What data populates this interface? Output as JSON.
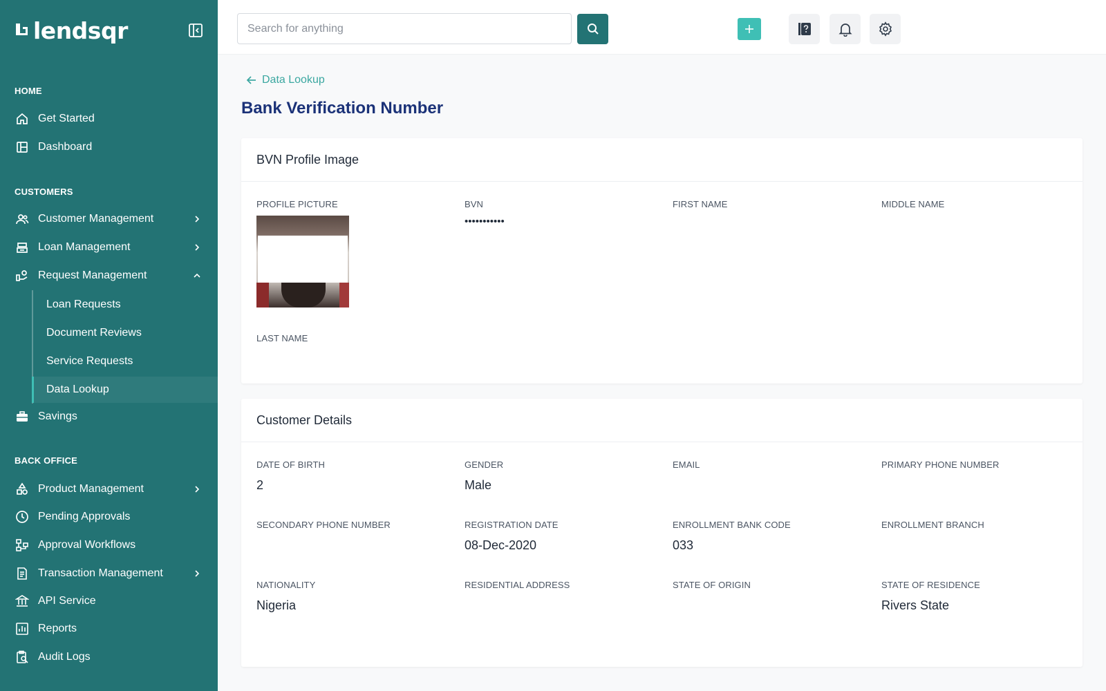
{
  "brand": {
    "name": "lendsqr"
  },
  "sidebar": {
    "sections": {
      "home": "HOME",
      "customers": "CUSTOMERS",
      "back_office": "BACK OFFICE"
    },
    "home_items": [
      {
        "label": "Get Started",
        "icon": "home-icon"
      },
      {
        "label": "Dashboard",
        "icon": "dashboard-icon"
      }
    ],
    "customer_items": [
      {
        "label": "Customer Management",
        "icon": "users-icon"
      },
      {
        "label": "Loan Management",
        "icon": "loan-icon"
      },
      {
        "label": "Request Management",
        "icon": "request-icon"
      }
    ],
    "request_sub_items": [
      {
        "label": "Loan Requests"
      },
      {
        "label": "Document Reviews"
      },
      {
        "label": "Service Requests"
      },
      {
        "label": "Data Lookup"
      }
    ],
    "savings": {
      "label": "Savings",
      "icon": "briefcase-icon"
    },
    "back_office_items": [
      {
        "label": "Product Management",
        "icon": "shapes-icon"
      },
      {
        "label": "Pending Approvals",
        "icon": "clock-icon"
      },
      {
        "label": "Approval Workflows",
        "icon": "workflow-icon"
      },
      {
        "label": "Transaction Management",
        "icon": "transaction-icon"
      },
      {
        "label": "API Service",
        "icon": "bank-icon"
      },
      {
        "label": "Reports",
        "icon": "report-icon"
      },
      {
        "label": "Audit Logs",
        "icon": "audit-icon"
      }
    ]
  },
  "topbar": {
    "search_placeholder": "Search for anything"
  },
  "main": {
    "back_link": "Data Lookup",
    "title": "Bank Verification Number",
    "profile_card": {
      "title": "BVN Profile Image",
      "fields": {
        "profile_picture": "PROFILE PICTURE",
        "bvn_label": "BVN",
        "bvn_value": "•••••••••••",
        "first_name": "FIRST NAME",
        "middle_name": "MIDDLE NAME",
        "last_name": "LAST NAME"
      }
    },
    "details_card": {
      "title": "Customer Details",
      "fields": [
        {
          "label": "DATE OF BIRTH",
          "value": "2"
        },
        {
          "label": "GENDER",
          "value": "Male"
        },
        {
          "label": "EMAIL",
          "value": ""
        },
        {
          "label": "PRIMARY PHONE NUMBER",
          "value": ""
        },
        {
          "label": "SECONDARY PHONE NUMBER",
          "value": ""
        },
        {
          "label": "REGISTRATION DATE",
          "value": "08-Dec-2020"
        },
        {
          "label": "ENROLLMENT BANK CODE",
          "value": "033"
        },
        {
          "label": "ENROLLMENT BRANCH",
          "value": ""
        },
        {
          "label": "NATIONALITY",
          "value": "Nigeria"
        },
        {
          "label": "RESIDENTIAL ADDRESS",
          "value": ""
        },
        {
          "label": "STATE OF ORIGIN",
          "value": ""
        },
        {
          "label": "STATE OF RESIDENCE",
          "value": "Rivers State"
        }
      ]
    }
  },
  "colors": {
    "sidebar_bg": "#237374",
    "accent": "#3fbfb5",
    "title": "#1b3278"
  }
}
